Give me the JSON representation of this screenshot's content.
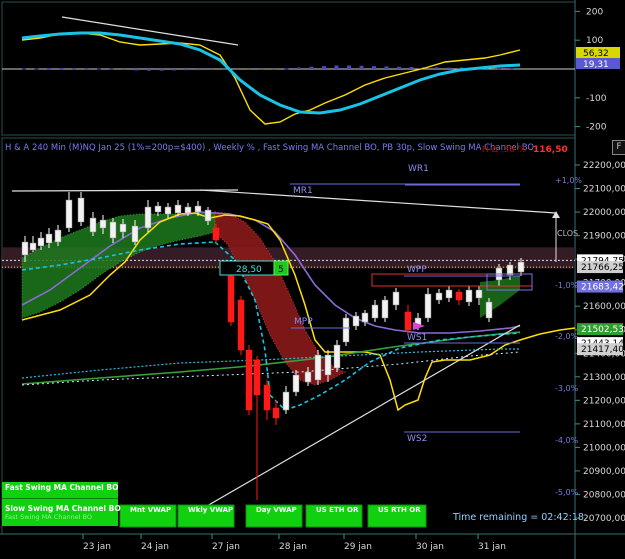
{
  "title": "H & A 240 Min (M)NQ Jan 25  (1%=200p=$400) , Weekly % , Fast Swing MA Channel BO, PB 30p, Slow Swing MA Channel BO",
  "pnl_text": "-116,50",
  "pnl_prefix": "H Δ ,38 %",
  "corner_button": "F",
  "oscillator": {
    "ticks": [
      "200",
      "100",
      "-100",
      "-200"
    ],
    "value_badges": [
      {
        "text": "56,32",
        "color": "#ffff33",
        "bg": "#d8d800"
      },
      {
        "text": "19,31",
        "color": "#ffffff",
        "bg": "#5a5ad0"
      }
    ]
  },
  "price_axis": {
    "ticks": [
      "22200,00",
      "22100,00",
      "22000,00",
      "21900,00",
      "21800,00",
      "21700,00",
      "21600,00",
      "21500,00",
      "21400,00",
      "21300,00",
      "21200,00",
      "21100,00",
      "21000,00",
      "20900,00",
      "20800,00",
      "20700,00"
    ],
    "badges": [
      {
        "text": "21794,75",
        "bg": "#ffffff",
        "color": "#000000"
      },
      {
        "text": "21766,25",
        "bg": "#cfcfcf",
        "color": "#000000"
      },
      {
        "text": "21683,42",
        "bg": "#7070e0",
        "color": "#ffffff"
      },
      {
        "text": "21502,53",
        "bg": "#2e9e2e",
        "color": "#ffffff"
      },
      {
        "text": "21443,14",
        "bg": "#ffffff",
        "color": "#000000"
      },
      {
        "text": "21417,40",
        "bg": "#cfcfcf",
        "color": "#000000"
      }
    ]
  },
  "pct_labels": [
    "+1,0%",
    "-1,0%",
    "-2,0%",
    "-3,0%",
    "-4,0%",
    "-5,0%"
  ],
  "levels": [
    "WR1",
    "MR1",
    "WPP",
    "MPP",
    "WS1",
    "WS2"
  ],
  "clos_label": "CLOS",
  "trade_box": {
    "value": "28,50",
    "count": "5"
  },
  "x_axis": [
    "23 jan",
    "24 jan",
    "27 jan",
    "28 jan",
    "29 jan",
    "30 jan",
    "31 jan"
  ],
  "legend_panel": {
    "line1": "Fast Swing MA Channel BO",
    "line2": "Slow Swing MA Channel BO",
    "line3": "Fast Swing MA Channel BO"
  },
  "buttons": [
    "Mnt VWAP",
    "Wkly VWAP",
    "Day VWAP",
    "US ETH OR",
    "US RTH OR"
  ],
  "time_remaining": "Time remaining = 02:42:18",
  "colors": {
    "bull": "#ffffff",
    "bear": "#ff1a1a",
    "green_fill": "#1e7a1e",
    "red_fill": "#8a1a1a",
    "yellow": "#ffe000",
    "cyan": "#19c3e6",
    "purple": "#8c6ad8",
    "green_line": "#3aa13a",
    "grid": "#1f3f3f"
  }
}
